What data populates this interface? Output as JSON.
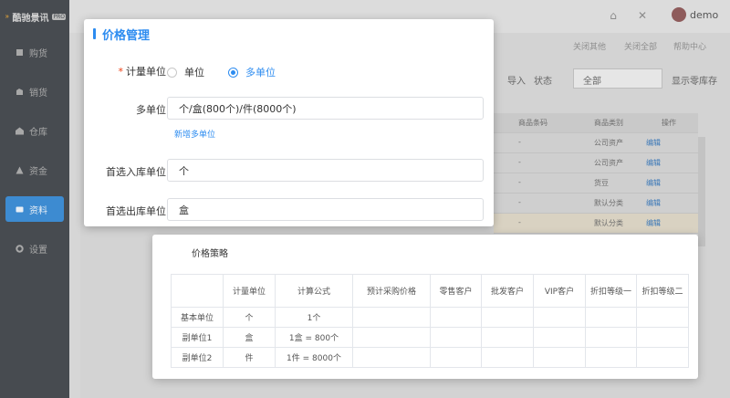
{
  "app": {
    "logo_text": "酷驰景讯",
    "logo_tag": "PRO",
    "user": "demo"
  },
  "sidebar": {
    "items": [
      {
        "label": "购货",
        "icon": "purchase-icon",
        "active": false
      },
      {
        "label": "销货",
        "icon": "sales-icon",
        "active": false
      },
      {
        "label": "仓库",
        "icon": "warehouse-icon",
        "active": false
      },
      {
        "label": "资金",
        "icon": "funds-icon",
        "active": false
      },
      {
        "label": "资料",
        "icon": "data-icon",
        "active": true
      },
      {
        "label": "设置",
        "icon": "gear-icon",
        "active": false
      }
    ]
  },
  "topbar": {
    "tab_actions": [
      "关闭其他",
      "关闭全部",
      "帮助中心"
    ]
  },
  "toolbar": {
    "import_label": "导入",
    "status_label": "状态",
    "status_value": "全部",
    "show_zero_stock": "显示零库存"
  },
  "background_table": {
    "headers": [
      "商品条码",
      "商品类别",
      "操作"
    ],
    "rows": [
      {
        "barcode": "-",
        "category": "公司资产",
        "action": "编辑"
      },
      {
        "barcode": "-",
        "category": "公司资产",
        "action": "编辑"
      },
      {
        "barcode": "-",
        "category": "货豆",
        "action": "编辑"
      },
      {
        "barcode": "-",
        "category": "默认分类",
        "action": "编辑"
      },
      {
        "barcode": "-",
        "category": "默认分类",
        "action": "编辑"
      }
    ]
  },
  "dialog": {
    "title": "价格管理",
    "unit_type": {
      "label": "计量单位",
      "required_mark": "*",
      "options": [
        "单位",
        "多单位"
      ],
      "selected": "多单位"
    },
    "multi_unit": {
      "label": "多单位",
      "value": "个/盒(800个)/件(8000个)",
      "add_link": "新增多单位"
    },
    "default_in_unit": {
      "label": "首选入库单位",
      "value": "个"
    },
    "default_out_unit": {
      "label": "首选出库单位",
      "value": "盒"
    }
  },
  "strategy": {
    "title": "价格策略",
    "headers": [
      "",
      "计量单位",
      "计算公式",
      "预计采购价格",
      "零售客户",
      "批发客户",
      "VIP客户",
      "折扣等级一",
      "折扣等级二"
    ],
    "rows": [
      {
        "name": "基本单位",
        "unit": "个",
        "formula": "1个"
      },
      {
        "name": "副单位1",
        "unit": "盒",
        "formula": "1盒 = 800个"
      },
      {
        "name": "副单位2",
        "unit": "件",
        "formula": "1件 = 8000个"
      }
    ]
  }
}
